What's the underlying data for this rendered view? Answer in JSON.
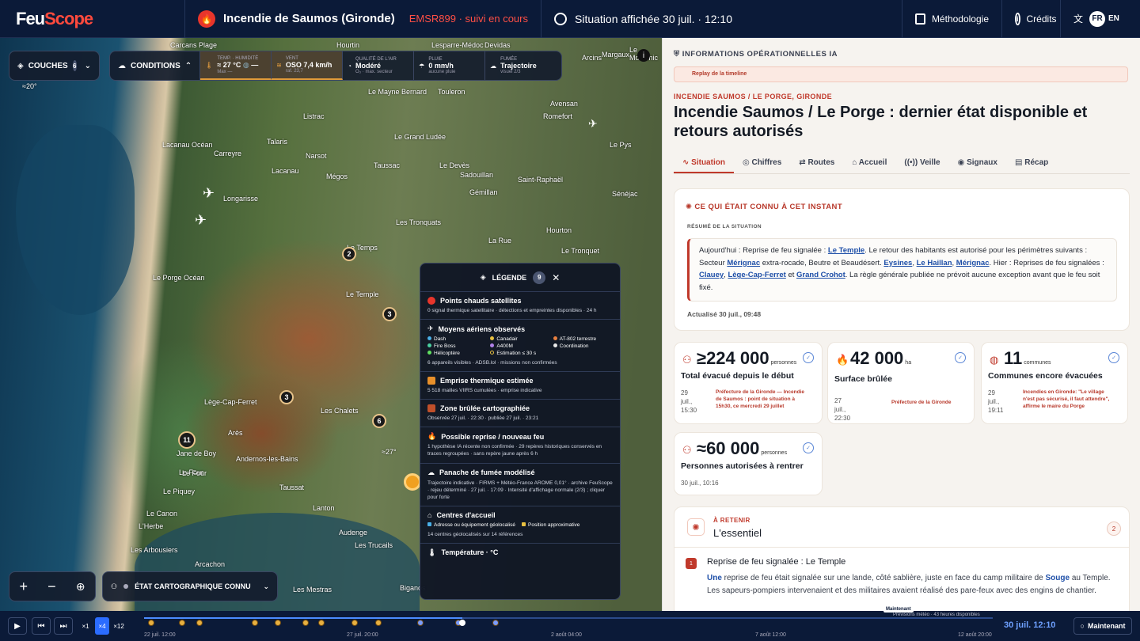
{
  "header": {
    "logo_a": "Feu",
    "logo_b": "Scope",
    "title": "Incendie de Saumos (Gironde)",
    "emsr": "EMSR899 · suivi en cours",
    "situation": "Situation affichée 30 juil. · 12:10",
    "methodologie": "Méthodologie",
    "credits": "Crédits",
    "lang_on": "FR",
    "lang_off": "EN"
  },
  "map": {
    "couches_label": "COUCHES",
    "couches_count": "6",
    "conditions_label": "CONDITIONS",
    "conditions": [
      {
        "label": "TEMP. · HUMIDITÉ",
        "value": "≈ 27 °C",
        "value2": "—",
        "sub": "Max —"
      },
      {
        "label": "VENT",
        "value": "OSO 7,4 km/h",
        "sub": "raf. 23,7"
      },
      {
        "label": "QUALITÉ DE L'AIR",
        "value": "Modéré",
        "sub": "O₃ · max. secteur"
      },
      {
        "label": "PLUIE",
        "value": "0 mm/h",
        "sub": "aucune pluie"
      },
      {
        "label": "FUMÉE",
        "value": "Trajectoire",
        "sub": "visuel 2/3"
      }
    ],
    "etat_label": "ÉTAT CARTOGRAPHIQUE CONNU",
    "labels": [
      "Carcans Plage",
      "Hourtin",
      "Lesparre-Médoc",
      "Devidas",
      "Arcins",
      "Margaux",
      "Le Moutchic",
      "Lacanau Océan",
      "Talaris",
      "Listrac",
      "Le Mayne Bernard",
      "Touleron",
      "Avensan",
      "Romefort",
      "Carreyre",
      "Narsot",
      "Le Grand Ludée",
      "Le Pys",
      "Taussac",
      "Le Devès",
      "Saint-Raphaël",
      "Mégos",
      "Lacanau",
      "Sadouillan",
      "Longarisse",
      "Gémillan",
      "Sénéjac",
      "Le Porge Océan",
      "Les Tronquats",
      "Hourton",
      "Le Temple",
      "Le Tronquet",
      "Lège-Cap-Ferret",
      "Arès",
      "Les Chalets",
      "Jane de Boy",
      "Andernos-les-Bains",
      "Le Four",
      "Taussat",
      "Le Piquey",
      "Le Canon",
      "L'Herbe",
      "Les Arbousiers",
      "Arcachon",
      "Lanton",
      "Audenge",
      "Les Trucails",
      "Les Mestras",
      "Biganos",
      "La Rue",
      "Le Temps",
      "Le Four"
    ],
    "clusters": [
      "2",
      "3",
      "3",
      "6",
      "11"
    ],
    "angle_a": "≈20°",
    "angle_b": "≈27°",
    "info_icon": "i"
  },
  "legend": {
    "title": "LÉGENDE",
    "count": "9",
    "sections": [
      {
        "title": "Points chauds satellites",
        "desc": "0 signal thermique satellitaire · détections et empreintes disponibles · 24 h"
      },
      {
        "title": "Moyens aériens observés",
        "desc": "6 appareils visibles · ADSB.lol · missions non confirmées"
      },
      {
        "title": "Emprise thermique estimée",
        "desc": "5 518 mailles VIIRS cumulées · emprise indicative"
      },
      {
        "title": "Zone brûlée cartographiée",
        "desc": "Observée 27 juil. · 22:30 · publiée 27 juil. · 23:21"
      },
      {
        "title": "Possible reprise / nouveau feu",
        "desc": "1 hypothèse IA récente non confirmée · 29 repères historiques conservés en traces regroupées · sans repère jaune après 6 h"
      },
      {
        "title": "Panache de fumée modélisé",
        "desc": "Trajectoire indicative · FIRMS + Météo-France AROME 0,01° · archive FeuScope · rejeu déterminé · 27 juil. · 17:09 · Intensité d'affichage normale (2/3) ; cliquer pour forte"
      },
      {
        "title": "Centres d'accueil",
        "desc": "14 centres géolocalisés sur 14 références"
      },
      {
        "title": "Température · °C",
        "desc": ""
      }
    ],
    "aerial": [
      "Dash",
      "Canadair",
      "AT-802 terrestre",
      "Fire Boss",
      "A400M",
      "Coordination",
      "Hélicoptère",
      "Estimation ≤ 30 s"
    ],
    "centres": [
      "Adresse ou équipement géolocalisé",
      "Position approximative"
    ]
  },
  "timeline": {
    "speeds": [
      "×1",
      "×4",
      "×12"
    ],
    "dates": [
      "22 juil. 12:00",
      "27 juil. 20:00",
      "2 août 04:00",
      "7 août 12:00",
      "12 août 20:00"
    ],
    "maintenant_tag": "Maintenant",
    "previsions": "Prévisions météo · 43 heures disponibles",
    "now": "30 juil. 12:10",
    "maintenant": "Maintenant",
    "progress": 0.375
  },
  "panel": {
    "info_label": "INFORMATIONS OPÉRATIONNELLES IA",
    "replay": "Replay de la timeline",
    "kicker": "INCENDIE SAUMOS / LE PORGE, GIRONDE",
    "title": "Incendie Saumos / Le Porge : dernier état disponible et retours autorisés",
    "tabs": [
      "Situation",
      "Chiffres",
      "Routes",
      "Accueil",
      "Veille",
      "Signaux",
      "Récap"
    ],
    "connu_title": "CE QUI ÉTAIT CONNU À CET INSTANT",
    "resume_label": "RÉSUMÉ DE LA SITUATION",
    "resume": {
      "p1": "Aujourd'hui : Reprise de feu signalée : ",
      "l1": "Le Temple",
      "p2": ". Le retour des habitants est autorisé pour les périmètres suivants : Secteur ",
      "l2": "Mérignac",
      "p3": " extra-rocade, Beutre et Beaudésert. ",
      "l3": "Eysines",
      "p4": ", ",
      "l4": "Le Haillan",
      "p5": ", ",
      "l5": "Mérignac",
      "p6": ". Hier : Reprises de feu signalées : ",
      "l6": "Clauey",
      "p7": ", ",
      "l7": "Lège-Cap-Ferret",
      "p8": " et ",
      "l8": "Grand Crohot",
      "p9": ". La règle générale publiée ne prévoit aucune exception avant que le feu soit fixé."
    },
    "updated": "Actualisé 30 juil., 09:48",
    "stats": [
      {
        "value": "≥224 000",
        "unit": "personnes",
        "label": "Total évacué depuis le début",
        "date": "29 juil., 15:30",
        "source": "Préfecture de la Gironde — Incendie de Saumos : point de situation à 15h30, ce mercredi 29 juillet"
      },
      {
        "value": "42 000",
        "unit": "ha",
        "label": "Surface brûlée",
        "date": "27 juil., 22:30",
        "source": "Préfecture de la Gironde"
      },
      {
        "value": "11",
        "unit": "communes",
        "label": "Communes encore évacuées",
        "date": "29 juil., 19:11",
        "source": "Incendies en Gironde: \"Le village n'est pas sécurisé, il faut attendre\", affirme le maire du Porge"
      },
      {
        "value": "≈60 000",
        "unit": "personnes",
        "label": "Personnes autorisées à rentrer",
        "date": "30 juil., 10:16",
        "source": ""
      }
    ],
    "retenir": {
      "kicker": "À RETENIR",
      "title": "L'essentiel",
      "count": "2",
      "item_num": "1",
      "item_title": "Reprise de feu signalée : Le Temple",
      "b1": "Une",
      "t1": " reprise de feu était signalée sur une lande, côté sablière, juste en face du camp militaire de ",
      "b2": "Souge",
      "t2": " au Temple. Les sapeurs-pompiers intervenaient et des militaires avaient réalisé des pare-feux avec des engins de chantier."
    }
  }
}
